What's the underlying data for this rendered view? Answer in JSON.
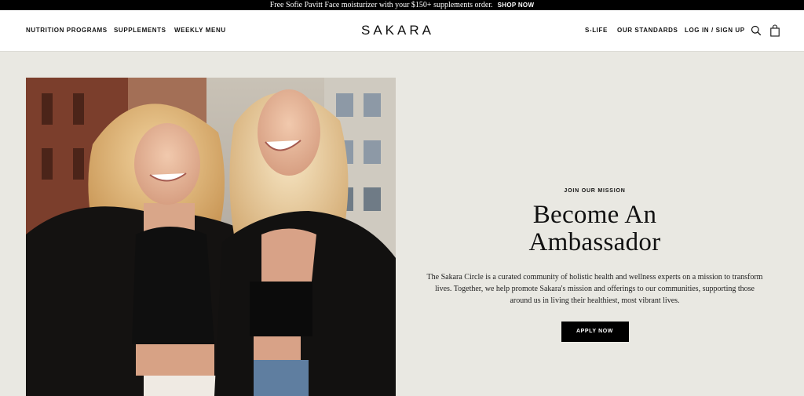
{
  "promo": {
    "message": "Free Sofie Pavitt Face moisturizer with your $150+ supplements order.",
    "cta": "SHOP NOW"
  },
  "nav": {
    "left": [
      "NUTRITION PROGRAMS",
      "SUPPLEMENTS",
      "WEEKLY MENU"
    ],
    "brand": "SAKARA",
    "right": [
      "S-LIFE",
      "OUR STANDARDS",
      "LOG IN / SIGN UP"
    ],
    "icons": [
      "search-icon",
      "bag-icon"
    ]
  },
  "hero": {
    "image": "two-women-laughing-photo",
    "eyebrow": "JOIN OUR MISSION",
    "headline_line1": "Become An",
    "headline_line2": "Ambassador",
    "body": "The Sakara Circle is a curated community of holistic health and wellness experts on a mission to transform lives. Together, we help promote Sakara's mission and offerings to our communities, supporting those around us in living their healthiest, most vibrant lives.",
    "cta": "APPLY NOW"
  },
  "colors": {
    "background": "#e9e8e2",
    "header": "#ffffff",
    "promo_bar": "#000000",
    "button": "#000000"
  }
}
